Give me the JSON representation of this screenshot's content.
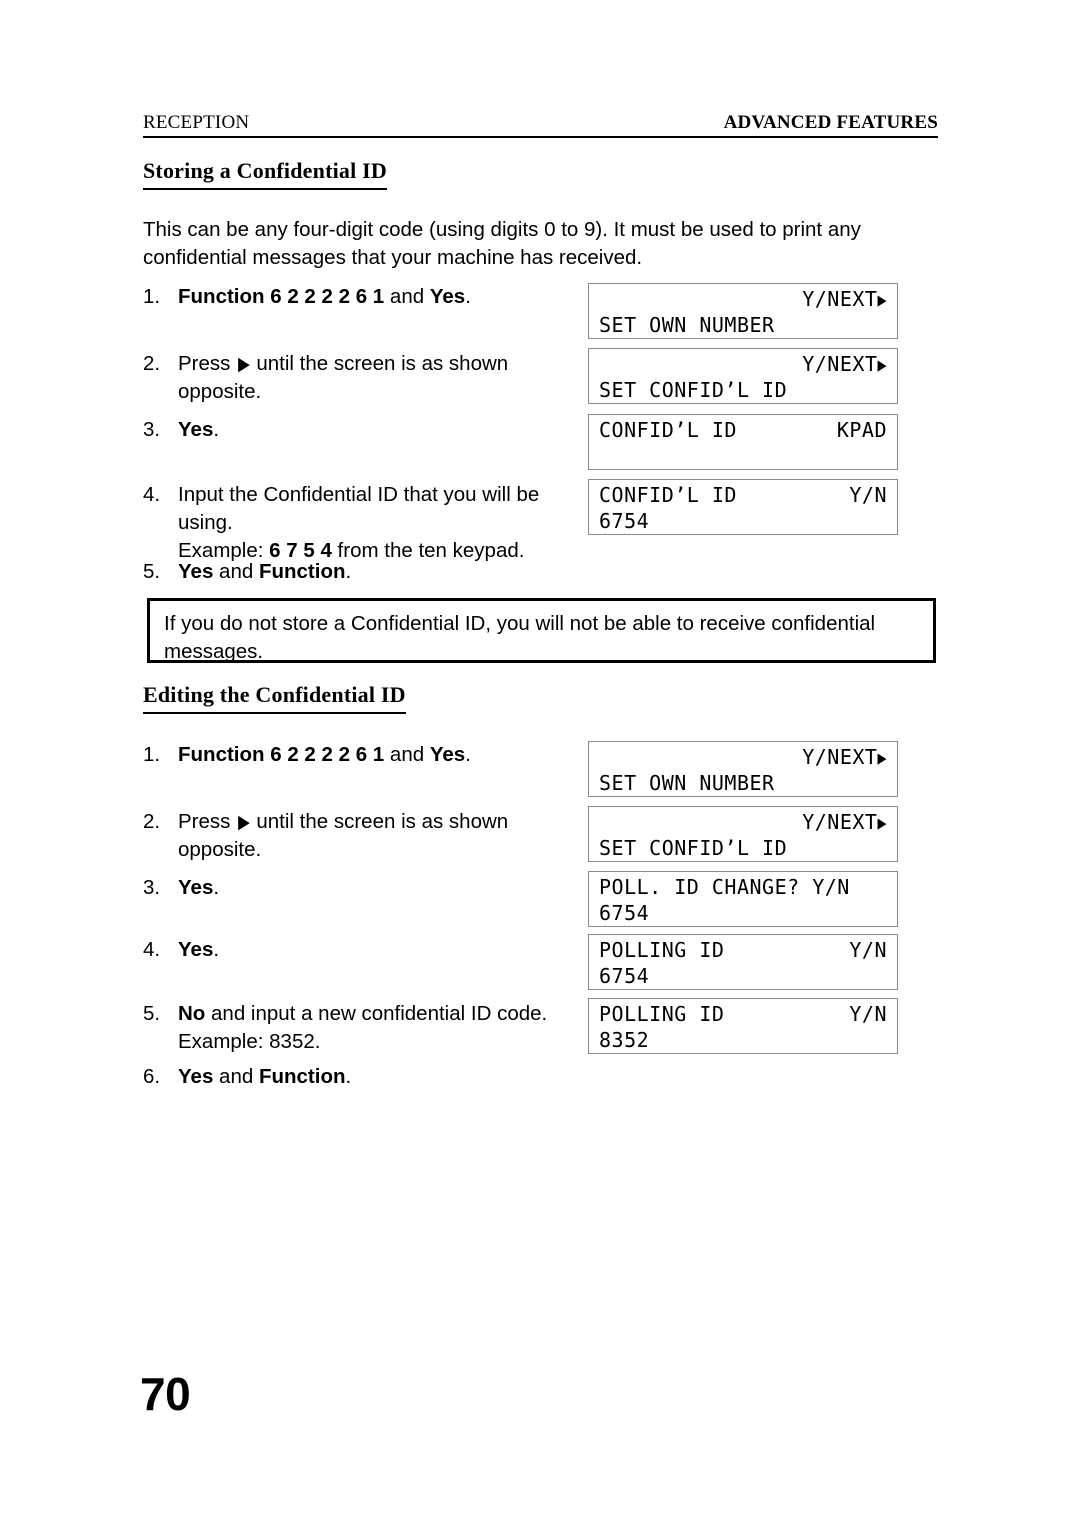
{
  "header": {
    "left": "RECEPTION",
    "right": "ADVANCED FEATURES"
  },
  "sections": [
    {
      "heading": "Storing a Confidential ID",
      "intro": "This can be any four-digit code (using digits 0 to 9). It must be used to print any confidential messages that your machine has received.",
      "steps": [
        {
          "num": "1.",
          "text_1": "Function 6 2 2 2 2 6 1",
          "text_2": " and ",
          "text_3": "Yes",
          "text_4": "."
        },
        {
          "num": "2.",
          "text_1": "Press ",
          "text_2": " until the screen is as shown opposite."
        },
        {
          "num": "3.",
          "text_1": "Yes",
          "text_2": "."
        },
        {
          "num": "4.",
          "text_1": "Input the Confidential ID that you will be using.",
          "text_2": "Example: ",
          "text_3": "6 7 5 4",
          "text_4": " from the ten keypad."
        },
        {
          "num": "5.",
          "text_1": "Yes",
          "text_2": " and ",
          "text_3": "Function",
          "text_4": "."
        }
      ]
    },
    {
      "heading": "Editing the Confidential ID",
      "steps": [
        {
          "num": "1.",
          "text_1": "Function 6 2 2 2 2 6 1",
          "text_2": " and ",
          "text_3": "Yes",
          "text_4": "."
        },
        {
          "num": "2.",
          "text_1": "Press ",
          "text_2": " until the screen is as shown opposite."
        },
        {
          "num": "3.",
          "text_1": "Yes",
          "text_2": "."
        },
        {
          "num": "4.",
          "text_1": "Yes",
          "text_2": "."
        },
        {
          "num": "5.",
          "text_1": "No",
          "text_2": " and input a new confidential ID code.",
          "text_3": "Example: 8352."
        },
        {
          "num": "6.",
          "text_1": "Yes",
          "text_2": " and ",
          "text_3": "Function",
          "text_4": "."
        }
      ]
    }
  ],
  "lcd_panels": [
    {
      "id": "lcd-1",
      "line1_left": "",
      "line1_right": "Y/NEXT",
      "line1_arrow": "▶",
      "line2_left": "SET OWN NUMBER",
      "line2_right": ""
    },
    {
      "id": "lcd-2",
      "line1_left": "",
      "line1_right": "Y/NEXT",
      "line1_arrow": "▶",
      "line2_left": "SET CONFID’L ID",
      "line2_right": ""
    },
    {
      "id": "lcd-3",
      "line1_left": "CONFID’L ID",
      "line1_right": "KPAD",
      "line1_arrow": "",
      "line2_left": "",
      "line2_right": ""
    },
    {
      "id": "lcd-4",
      "line1_left": "CONFID’L ID",
      "line1_right": "Y/N",
      "line1_arrow": "",
      "line2_left": "6754",
      "line2_right": ""
    },
    {
      "id": "lcd-5",
      "line1_left": "",
      "line1_right": "Y/NEXT",
      "line1_arrow": "▶",
      "line2_left": "SET OWN NUMBER",
      "line2_right": ""
    },
    {
      "id": "lcd-6",
      "line1_left": "",
      "line1_right": "Y/NEXT",
      "line1_arrow": "▶",
      "line2_left": "SET CONFID’L ID",
      "line2_right": ""
    },
    {
      "id": "lcd-7",
      "line1_left": "POLL. ID CHANGE? Y/N",
      "line1_right": "",
      "line1_arrow": "",
      "line2_left": "6754",
      "line2_right": ""
    },
    {
      "id": "lcd-8",
      "line1_left": "POLLING ID",
      "line1_right": "Y/N",
      "line1_arrow": "",
      "line2_left": "6754",
      "line2_right": ""
    },
    {
      "id": "lcd-9",
      "line1_left": "POLLING ID",
      "line1_right": "Y/N",
      "line1_arrow": "",
      "line2_left": "8352",
      "line2_right": ""
    }
  ],
  "note": {
    "text": "If you do not store a Confidential ID, you will not be able to receive confidential messages."
  },
  "page_number": "70",
  "glyphs": {
    "right_arrow": "▶"
  }
}
